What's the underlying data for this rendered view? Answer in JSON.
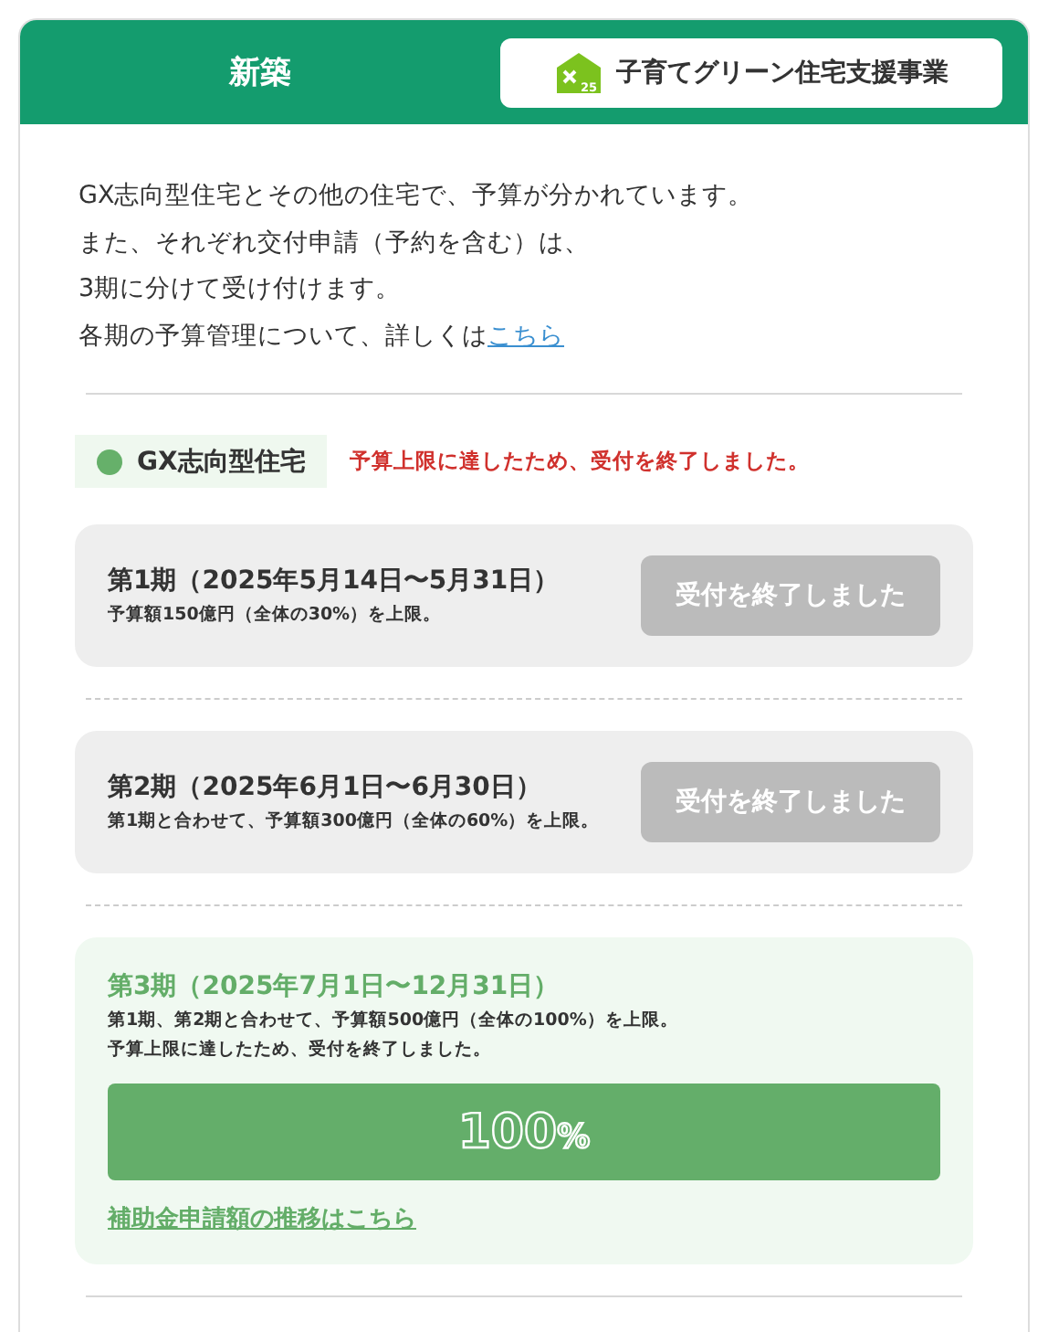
{
  "header": {
    "title": "新築",
    "badge": {
      "label": "子育てグリーン住宅支援事業",
      "logo_number": "25"
    }
  },
  "intro": {
    "lines": [
      "GX志向型住宅とその他の住宅で、予算が分かれています。",
      "また、それぞれ交付申請（予約を含む）は、",
      "3期に分けて受け付けます。",
      "各期の予算管理について、詳しくは"
    ],
    "link": "こちら"
  },
  "category": {
    "label": "GX志向型住宅",
    "color": "#66b06a",
    "notice": "予算上限に達したため、受付を終了しました。"
  },
  "periods": [
    {
      "kind": "closed",
      "title": "第1期（2025年5月14日〜5月31日）",
      "notes": [
        "予算額150億円（全体の30%）を上限。"
      ],
      "button": "受付を終了しました"
    },
    {
      "kind": "closed",
      "title": "第2期（2025年6月1日〜6月30日）",
      "notes": [
        "第1期と合わせて、予算額300億円（全体の60%）を上限。"
      ],
      "button": "受付を終了しました"
    },
    {
      "kind": "active",
      "title": "第3期（2025年7月1日〜12月31日）",
      "notes": [
        "第1期、第2期と合わせて、予算額500億円（全体の100%）を上限。",
        "予算上限に達したため、受付を終了しました。"
      ],
      "reading": "100",
      "unit": "%",
      "link": "補助金申請額の推移はこちら"
    }
  ]
}
